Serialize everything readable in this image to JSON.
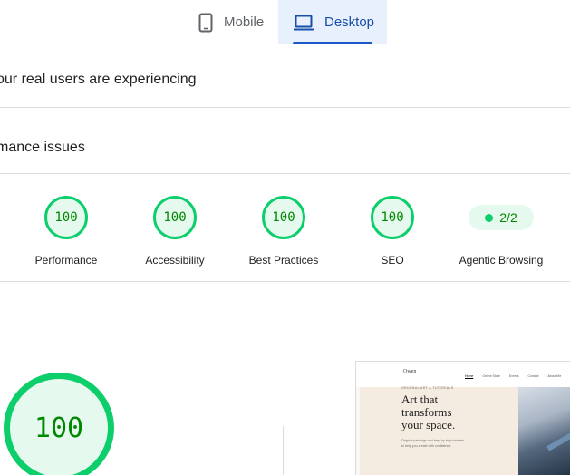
{
  "tabs": {
    "mobile_label": "Mobile",
    "desktop_label": "Desktop",
    "active": "desktop"
  },
  "sections": {
    "real_users_heading": "our real users are experiencing",
    "performance_issues_heading": "mance issues"
  },
  "scores": [
    {
      "label": "Performance",
      "value": "100"
    },
    {
      "label": "Accessibility",
      "value": "100"
    },
    {
      "label": "Best Practices",
      "value": "100"
    },
    {
      "label": "SEO",
      "value": "100"
    }
  ],
  "agentic": {
    "label": "Agentic Browsing",
    "value": "2/2"
  },
  "main_score": {
    "value": "100"
  },
  "thumbnail": {
    "logo": "Owen",
    "nav": [
      "Home",
      "Online Store",
      "Events",
      "Contact",
      "About Me"
    ],
    "eyebrow": "ORIGINAL ART & TUTORIALS",
    "headline_lines": [
      "Art that",
      "transforms",
      "your space."
    ],
    "sub_lines": [
      "Original paintings and step-by-step tutorials",
      "to help you create with confidence."
    ]
  },
  "colors": {
    "pass_green": "#0cce6b",
    "pass_text": "#008800",
    "pass_bg": "#e6f9ee",
    "tab_active_bg": "#e8f0fe",
    "tab_active_text": "#174ea6"
  }
}
